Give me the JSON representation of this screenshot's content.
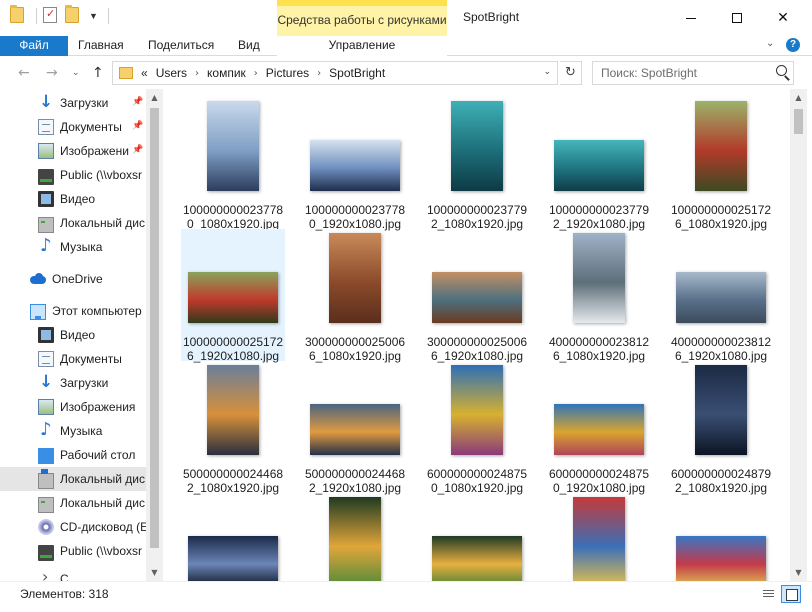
{
  "titlebar": {
    "context_tools": "Средства работы с рисунками",
    "window_title": "SpotBright"
  },
  "ribbon": {
    "tabs": [
      "Файл",
      "Главная",
      "Поделиться",
      "Вид"
    ],
    "context_tab": "Управление"
  },
  "address": {
    "prefix": "«",
    "crumbs": [
      "Users",
      "компик",
      "Pictures",
      "SpotBright"
    ],
    "search_placeholder": "Поиск: SpotBright"
  },
  "sidebar": {
    "items": [
      {
        "label": "Загрузки",
        "icon": "download-icon",
        "pinned": true
      },
      {
        "label": "Документы",
        "icon": "documents-icon",
        "pinned": true
      },
      {
        "label": "Изображени",
        "icon": "pictures-icon",
        "pinned": true
      },
      {
        "label": "Public (\\\\vboxsr",
        "icon": "network-drive-icon",
        "pinned": false
      },
      {
        "label": "Видео",
        "icon": "video-icon",
        "pinned": false
      },
      {
        "label": "Локальный дис",
        "icon": "local-disk-icon",
        "pinned": false
      },
      {
        "label": "Музыка",
        "icon": "music-icon",
        "pinned": false
      },
      {
        "label": "OneDrive",
        "icon": "onedrive-icon",
        "pinned": false
      },
      {
        "label": "Этот компьютер",
        "icon": "this-pc-icon",
        "pinned": false
      },
      {
        "label": "Видео",
        "icon": "video-icon",
        "pinned": false
      },
      {
        "label": "Документы",
        "icon": "documents-icon",
        "pinned": false
      },
      {
        "label": "Загрузки",
        "icon": "download-icon",
        "pinned": false
      },
      {
        "label": "Изображения",
        "icon": "pictures-icon",
        "pinned": false
      },
      {
        "label": "Музыка",
        "icon": "music-icon",
        "pinned": false
      },
      {
        "label": "Рабочий стол",
        "icon": "desktop-icon",
        "pinned": false
      },
      {
        "label": "Локальный дис",
        "icon": "windows-disk-icon",
        "pinned": false,
        "selected": true
      },
      {
        "label": "Локальный дис",
        "icon": "local-disk-icon",
        "pinned": false
      },
      {
        "label": "CD-дисковод (E",
        "icon": "cd-drive-icon",
        "pinned": false
      },
      {
        "label": "Public (\\\\vboxsr",
        "icon": "network-drive-icon",
        "pinned": false
      },
      {
        "label": "С",
        "icon": "network-icon",
        "pinned": false
      }
    ]
  },
  "files": [
    {
      "name": "1000000000237780_1080x1920.jpg",
      "orientation": "portrait",
      "palette": [
        "#c9d9ec",
        "#7f9fc4",
        "#2c3d5e"
      ]
    },
    {
      "name": "1000000000237780_1920x1080.jpg",
      "orientation": "landscape",
      "palette": [
        "#d6e2ef",
        "#6f8fbf",
        "#1f2e4d"
      ]
    },
    {
      "name": "1000000000237792_1080x1920.jpg",
      "orientation": "portrait",
      "palette": [
        "#3fb0b6",
        "#1d6f7a",
        "#0d3a45"
      ]
    },
    {
      "name": "1000000000237792_1920x1080.jpg",
      "orientation": "landscape",
      "palette": [
        "#46b6bc",
        "#1f7581",
        "#0f3c47"
      ]
    },
    {
      "name": "1000000000251726_1080x1920.jpg",
      "orientation": "portrait",
      "palette": [
        "#9bb36a",
        "#b23a2a",
        "#3d4a22"
      ]
    },
    {
      "name": "1000000000251726_1920x1080.jpg",
      "orientation": "landscape",
      "palette": [
        "#8aa35c",
        "#c0392b",
        "#2f3b1a"
      ],
      "selected": true
    },
    {
      "name": "3000000000250066_1080x1920.jpg",
      "orientation": "portrait",
      "palette": [
        "#c98a5a",
        "#8b4a2a",
        "#5a2e1c"
      ]
    },
    {
      "name": "3000000000250066_1920x1080.jpg",
      "orientation": "landscape",
      "palette": [
        "#c38f63",
        "#4d6f7f",
        "#6a3b22"
      ]
    },
    {
      "name": "4000000000238126_1080x1920.jpg",
      "orientation": "portrait",
      "palette": [
        "#9fb2c7",
        "#5d6f7a",
        "#e6e9ec"
      ]
    },
    {
      "name": "4000000000238126_1920x1080.jpg",
      "orientation": "landscape",
      "palette": [
        "#a8b9cb",
        "#59708a",
        "#3d4c5c"
      ]
    },
    {
      "name": "5000000000244682_1080x1920.jpg",
      "orientation": "portrait",
      "palette": [
        "#6a7f9a",
        "#d8903a",
        "#2a2f3f"
      ]
    },
    {
      "name": "5000000000244682_1920x1080.jpg",
      "orientation": "landscape",
      "palette": [
        "#4a6582",
        "#e09a3e",
        "#26304a"
      ]
    },
    {
      "name": "6000000000248750_1080x1920.jpg",
      "orientation": "portrait",
      "palette": [
        "#2d6fb7",
        "#d7b12f",
        "#8a3a7a"
      ]
    },
    {
      "name": "6000000000248750_1920x1080.jpg",
      "orientation": "landscape",
      "palette": [
        "#3274b8",
        "#d9a52e",
        "#b0445a"
      ]
    },
    {
      "name": "6000000000248792_1080x1920.jpg",
      "orientation": "portrait",
      "palette": [
        "#1b2a44",
        "#3a4f73",
        "#0c1424"
      ]
    },
    {
      "name": "",
      "orientation": "landscape",
      "palette": [
        "#1c2a4a",
        "#6b86b8",
        "#0e1526"
      ]
    },
    {
      "name": "",
      "orientation": "portrait",
      "palette": [
        "#1f3a22",
        "#e0a63a",
        "#4f8a3a"
      ]
    },
    {
      "name": "",
      "orientation": "landscape",
      "palette": [
        "#203a24",
        "#e8b040",
        "#4a7f36"
      ]
    },
    {
      "name": "",
      "orientation": "portrait",
      "palette": [
        "#c43a3a",
        "#3a6fb8",
        "#e8c24a"
      ]
    },
    {
      "name": "",
      "orientation": "landscape",
      "palette": [
        "#3a76c4",
        "#c23a4a",
        "#e0c250"
      ]
    }
  ],
  "status": {
    "count": "Элементов: 318"
  }
}
